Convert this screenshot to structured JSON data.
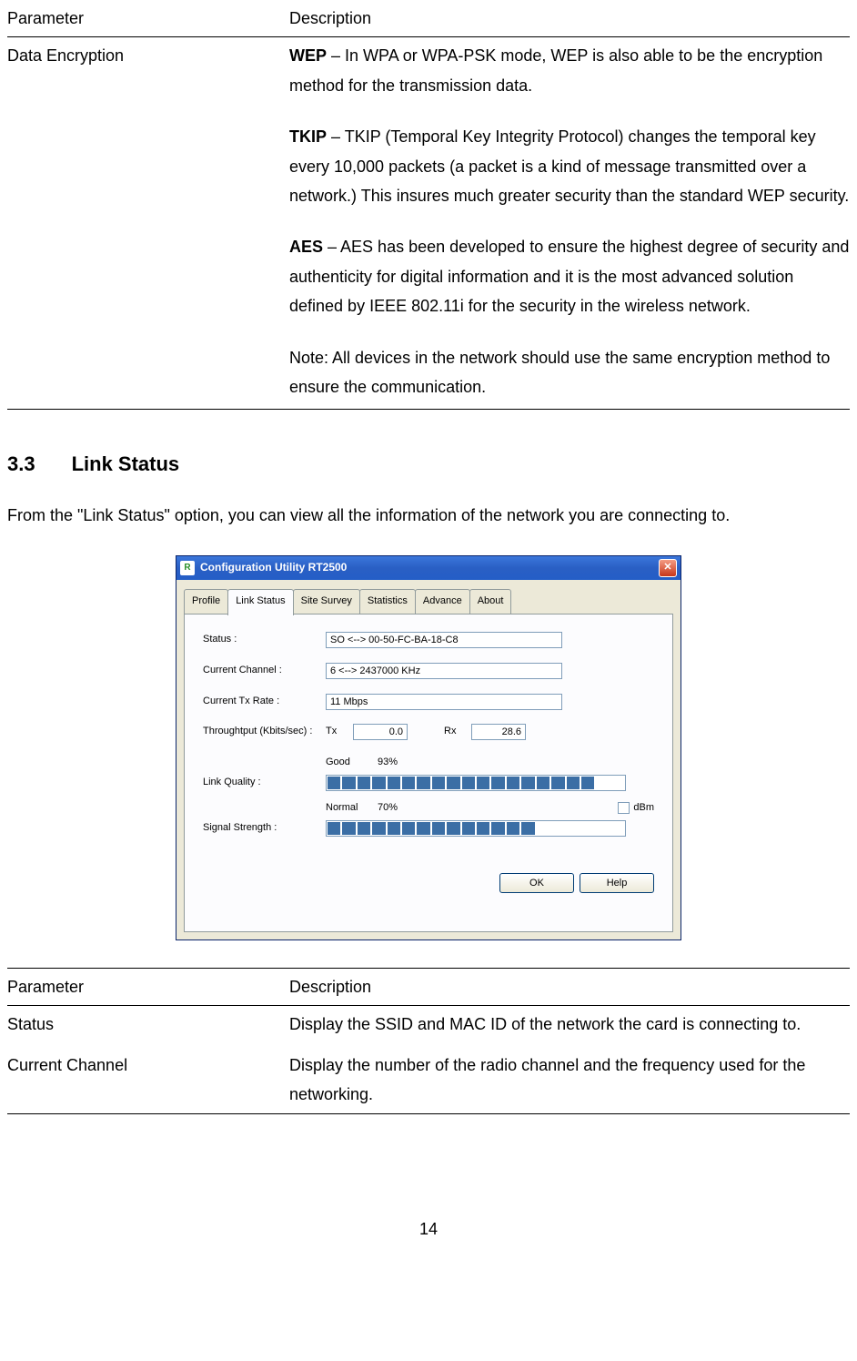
{
  "table1": {
    "header_param": "Parameter",
    "header_desc": "Description",
    "param1": "Data Encryption",
    "wep_bold": "WEP",
    "wep_text": " – In WPA or WPA-PSK mode, WEP is also able to be the encryption method for the transmission data.",
    "tkip_bold": "TKIP",
    "tkip_text": " – TKIP (Temporal Key Integrity Protocol) changes the temporal key every 10,000 packets (a packet is a kind of message transmitted over a network.) This insures much greater security than the standard WEP security.",
    "aes_bold": "AES",
    "aes_text": " – AES has been developed to ensure the highest degree of security and authenticity for digital information and it is the most advanced solution defined by IEEE 802.11i for the security in the wireless network.",
    "note_text": "Note: All devices in the network should use the same encryption method to ensure the communication."
  },
  "section": {
    "number": "3.3",
    "title": "Link Status",
    "intro": "From the \"Link Status\" option, you can view all the information of the network you are connecting to."
  },
  "window": {
    "title": "Configuration Utility RT2500",
    "icon_letter": "R",
    "close": "✕",
    "tabs": {
      "profile": "Profile",
      "link_status": "Link Status",
      "site_survey": "Site Survey",
      "statistics": "Statistics",
      "advance": "Advance",
      "about": "About"
    },
    "labels": {
      "status": "Status :",
      "current_channel": "Current Channel :",
      "current_tx_rate": "Current Tx Rate :",
      "throughput": "Throughtput (Kbits/sec) :",
      "tx": "Tx",
      "rx": "Rx",
      "link_quality": "Link Quality :",
      "signal_strength": "Signal Strength :",
      "dbm": "dBm"
    },
    "values": {
      "status": "SO <--> 00-50-FC-BA-18-C8",
      "channel": "6 <--> 2437000 KHz",
      "tx_rate": "11 Mbps",
      "tx_val": "0.0",
      "rx_val": "28.6",
      "link_quality_word": "Good",
      "link_quality_pct": "93%",
      "signal_word": "Normal",
      "signal_pct": "70%"
    },
    "buttons": {
      "ok": "OK",
      "help": "Help"
    }
  },
  "table2": {
    "header_param": "Parameter",
    "header_desc": "Description",
    "param_status": "Status",
    "desc_status": "Display the SSID and MAC ID of the network the card is connecting to.",
    "param_channel": "Current Channel",
    "desc_channel": "Display the number of the radio channel and the frequency used for the networking."
  },
  "page_number": "14"
}
